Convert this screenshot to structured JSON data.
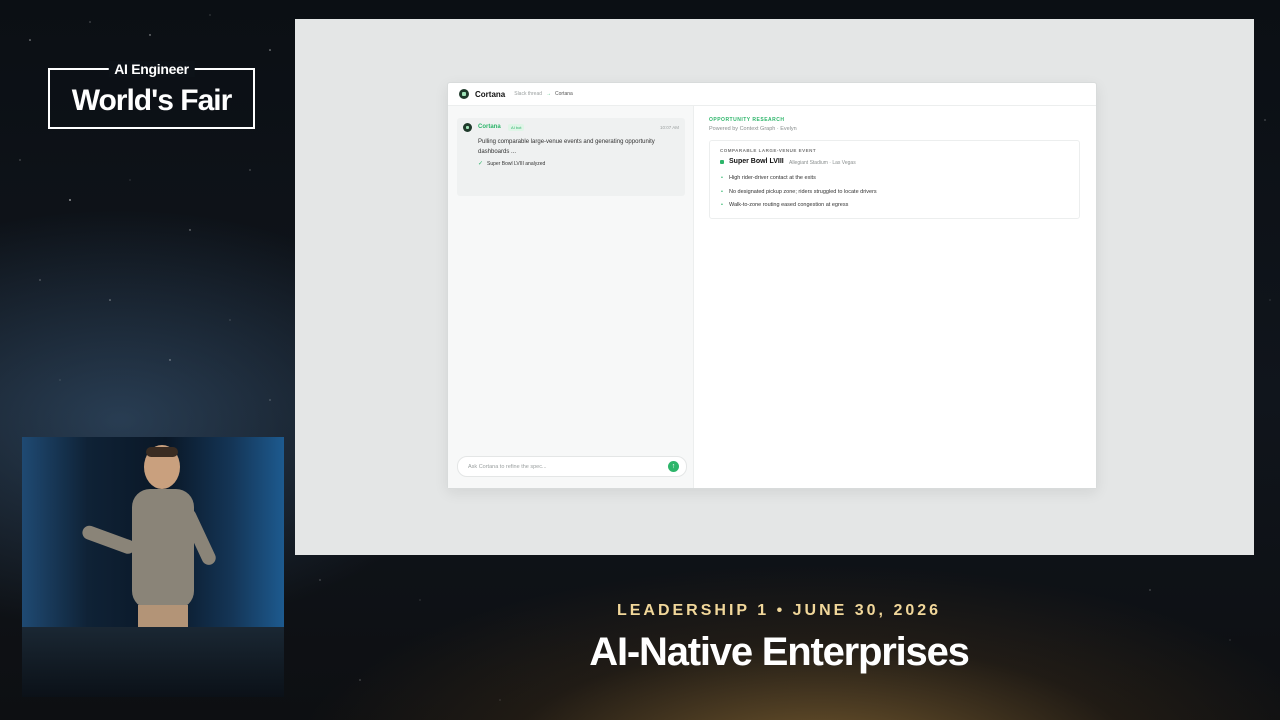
{
  "conference": {
    "logo_top": "AI Engineer",
    "logo_main": "World's Fair",
    "session_line": "LEADERSHIP 1 • JUNE 30, 2026",
    "talk_title": "AI-Native Enterprises"
  },
  "app": {
    "title": "Cortana",
    "breadcrumb": {
      "parent": "Slack thread",
      "arrow": "→",
      "current": "Cortana"
    },
    "message": {
      "sender": "Cortana",
      "badge": "AI bot",
      "time": "10:07 AM",
      "text": "Pulling comparable large-venue events and generating opportunity dashboards ...",
      "status_check": "✓",
      "status": "Super Bowl LVIII analyzed"
    },
    "input": {
      "placeholder": "Ask Cortana to refine the spec...",
      "send_icon": "send-arrow-icon",
      "send_glyph": "↑"
    },
    "research": {
      "eyebrow": "OPPORTUNITY RESEARCH",
      "subtitle": "Powered by Context Graph · Evelyn",
      "card": {
        "eyebrow": "COMPARABLE LARGE-VENUE EVENT",
        "title": "Super Bowl LVIII",
        "meta": "Allegiant Stadium · Las Vegas",
        "bullets": [
          "High rider-driver contact at the exits",
          "No designated pickup zone; riders struggled to locate drivers",
          "Walk-to-zone routing eased congestion at egress"
        ]
      }
    },
    "colors": {
      "accent": "#2db56a",
      "brand_dark": "#1f3a2b",
      "caption_gold": "#f1d79a"
    }
  }
}
